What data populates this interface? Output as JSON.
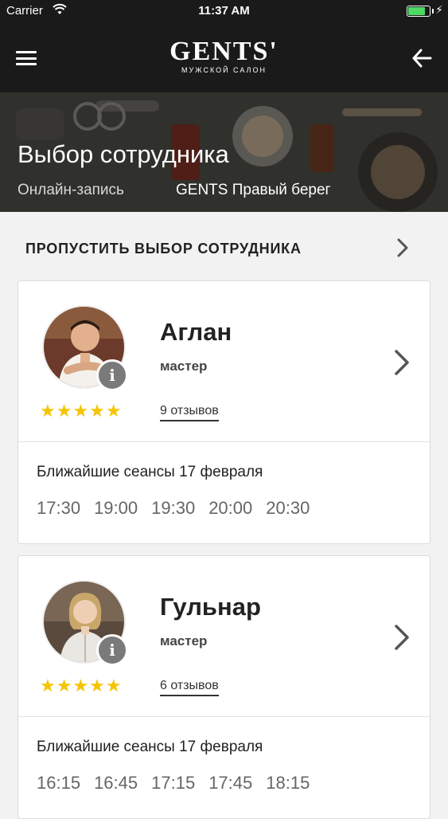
{
  "status": {
    "carrier": "Carrier",
    "time": "11:37 AM",
    "battery_level": 0.85
  },
  "nav": {
    "logo": "GENTS'",
    "logo_sub": "МУЖСКОЙ САЛОН"
  },
  "hero": {
    "title": "Выбор сотрудника",
    "breadcrumb": "Онлайн-запись",
    "salon": "GENTS Правый берег"
  },
  "skip": {
    "label": "ПРОПУСТИТЬ ВЫБОР СОТРУДНИКА"
  },
  "employees": [
    {
      "name": "Аглан",
      "role": "мастер",
      "rating": 5,
      "reviews": "9 отзывов",
      "sessions_label": "Ближайшие сеансы 17 февраля",
      "slots": [
        "17:30",
        "19:00",
        "19:30",
        "20:00",
        "20:30"
      ]
    },
    {
      "name": "Гульнар",
      "role": "мастер",
      "rating": 5,
      "reviews": "6 отзывов",
      "sessions_label": "Ближайшие сеансы 17 февраля",
      "slots": [
        "16:15",
        "16:45",
        "17:15",
        "17:45",
        "18:15"
      ]
    }
  ],
  "colors": {
    "accent_star": "#f5c400",
    "header": "#1a1a1a",
    "battery": "#4cd964"
  }
}
